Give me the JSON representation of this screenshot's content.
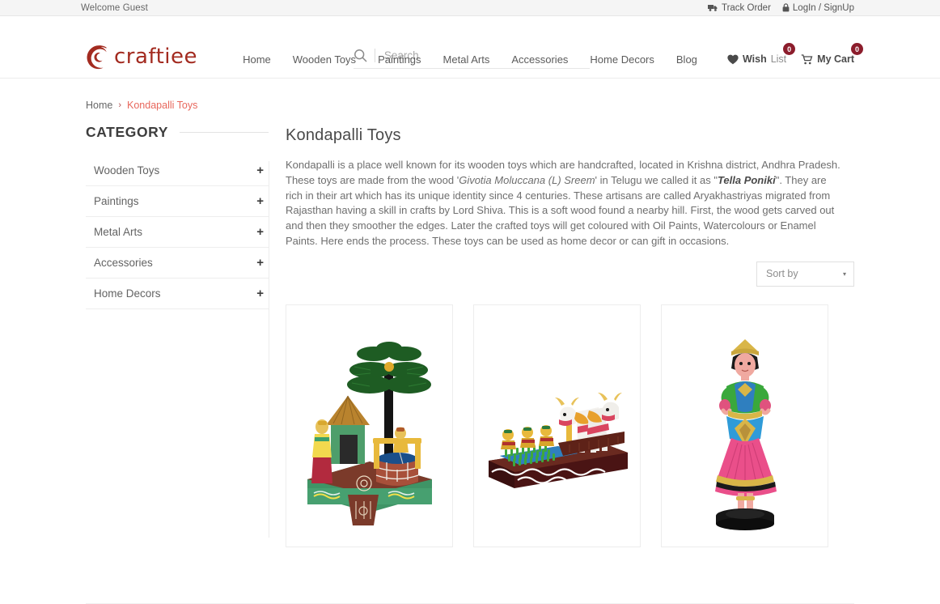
{
  "topbar": {
    "welcome": "Welcome Guest",
    "track_order": "Track Order",
    "login_signup": "LogIn / SignUp"
  },
  "header": {
    "logo_text": "craftiee",
    "search_placeholder": "Search",
    "search_value": "",
    "wish_label_strong": "Wish",
    "wish_label_light": "List",
    "wish_count": "0",
    "cart_label": "My Cart",
    "cart_count": "0"
  },
  "nav": {
    "items": [
      {
        "label": "Home"
      },
      {
        "label": "Wooden Toys"
      },
      {
        "label": "Paintings"
      },
      {
        "label": "Metal Arts"
      },
      {
        "label": "Accessories"
      },
      {
        "label": "Home Decors"
      },
      {
        "label": "Blog"
      }
    ]
  },
  "breadcrumb": {
    "home": "Home",
    "separator": "›",
    "current": "Kondapalli Toys"
  },
  "sidebar": {
    "title": "CATEGORY",
    "items": [
      {
        "label": "Wooden Toys",
        "expand": "+"
      },
      {
        "label": "Paintings",
        "expand": "+"
      },
      {
        "label": "Metal Arts",
        "expand": "+"
      },
      {
        "label": "Accessories",
        "expand": "+"
      },
      {
        "label": "Home Decors",
        "expand": "+"
      }
    ]
  },
  "main": {
    "title": "Kondapalli Toys",
    "intro_p1": "Kondapalli is a place well known for its wooden toys which are handcrafted, located in Krishna district, Andhra Pradesh. These toys are made from the wood '",
    "intro_italic": "Givotia Moluccana (L) Sreem",
    "intro_p2": "' in Telugu we called it as \"",
    "intro_bold_italic": "Tella Poniki",
    "intro_p3": "\". They are rich in their art which has its unique identity since 4 centuries. These artisans are called Aryakhastriyas migrated from Rajasthan having a skill in crafts by Lord Shiva. This is a soft wood found a nearby hill. First, the wood gets carved out and then they smoother the edges. Later the crafted toys will get coloured with Oil Paints, Watercolours or Enamel Paints. Here ends the process. These toys can be used as home decor or can gift in occasions.",
    "sort_label": "Sort by",
    "sort_caret": "▾",
    "products": [
      {
        "name": "village-hut-well-scene"
      },
      {
        "name": "bullock-plough-farming-scene"
      },
      {
        "name": "dancing-doll-figurine"
      }
    ]
  },
  "colors": {
    "brand": "#a32b20",
    "badge": "#8c1d2c",
    "accent_link": "#e8675c"
  }
}
